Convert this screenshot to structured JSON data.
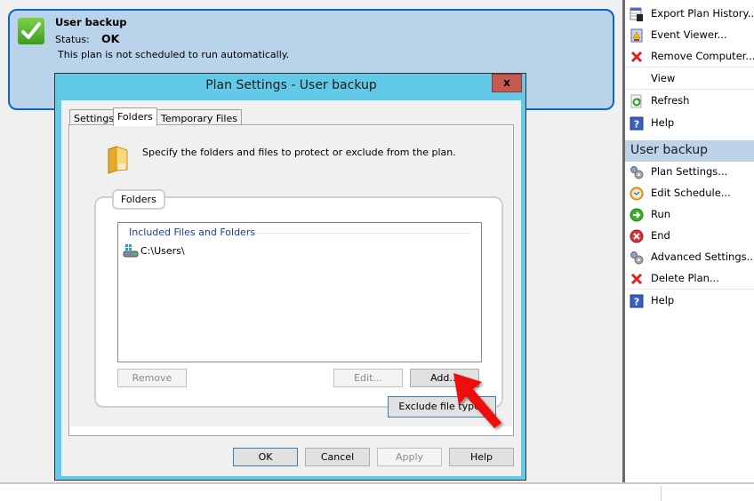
{
  "plan": {
    "name": "User backup",
    "status_label": "Status:",
    "status_value": "OK",
    "schedule_text": "This plan is not scheduled to run automatically."
  },
  "actions": {
    "top_items": [
      {
        "label": "Export Plan History...",
        "icon": "export-history-icon"
      },
      {
        "label": "Event Viewer...",
        "icon": "event-viewer-icon"
      },
      {
        "label": "Remove Computer...",
        "icon": "remove-x-icon"
      },
      {
        "label": "View",
        "icon": ""
      },
      {
        "label": "Refresh",
        "icon": "refresh-icon"
      },
      {
        "label": "Help",
        "icon": "help-icon"
      }
    ],
    "section_title": "User backup",
    "section_items": [
      {
        "label": "Plan Settings...",
        "icon": "gears-icon"
      },
      {
        "label": "Edit Schedule...",
        "icon": "clock-icon"
      },
      {
        "label": "Run",
        "icon": "run-arrow-icon"
      },
      {
        "label": "End",
        "icon": "end-icon"
      },
      {
        "label": "Advanced Settings...",
        "icon": "gears-icon"
      },
      {
        "label": "Delete Plan...",
        "icon": "delete-x-icon"
      },
      {
        "label": "Help",
        "icon": "help-icon"
      }
    ]
  },
  "dialog": {
    "title": "Plan Settings - User backup",
    "close_label": "x",
    "tabs": [
      "Settings",
      "Folders",
      "Temporary Files"
    ],
    "active_tab": "Folders",
    "intro": "Specify the folders and files to protect or exclude from the plan.",
    "group_label": "Folders",
    "list_header": "Included Files and Folders",
    "list_items": [
      "C:\\Users\\"
    ],
    "buttons": {
      "remove": "Remove",
      "edit": "Edit...",
      "add": "Add...",
      "exclude": "Exclude file types",
      "ok": "OK",
      "cancel": "Cancel",
      "apply": "Apply",
      "help": "Help"
    }
  }
}
